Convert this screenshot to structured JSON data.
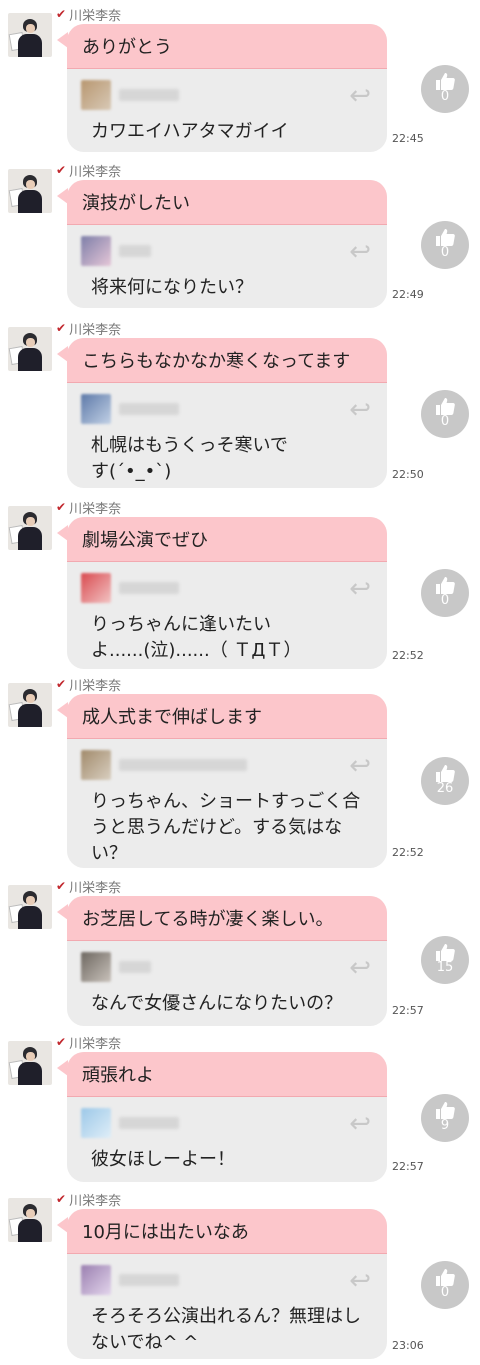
{
  "messages": [
    {
      "name": "川栄李奈",
      "post": "ありがとう",
      "reply_text": "カワエイハアタマガイイ",
      "time": "22:45",
      "likes": "0",
      "quote_colors": [
        "#b89770",
        "#d8c9b6"
      ]
    },
    {
      "name": "川栄李奈",
      "post": "演技がしたい",
      "reply_text": "将来何になりたい？",
      "time": "22:49",
      "likes": "0",
      "quote_colors": [
        "#7d7ea8",
        "#e6c7d8"
      ]
    },
    {
      "name": "川栄李奈",
      "post": "こちらもなかなか寒くなってます",
      "reply_text": "札幌はもうくっそ寒いです(´•_•`)",
      "time": "22:50",
      "likes": "0",
      "quote_colors": [
        "#5d79a8",
        "#c2d1e6"
      ]
    },
    {
      "name": "川栄李奈",
      "post": "劇場公演でぜひ",
      "reply_text": "りっちゃんに逢いたいよ......(泣)......（ ＴДＴ）",
      "time": "22:52",
      "likes": "0",
      "quote_colors": [
        "#d94a4f",
        "#f2c4c4"
      ]
    },
    {
      "name": "川栄李奈",
      "post": "成人式まで伸ばします",
      "reply_text": "りっちゃん、ショートすっごく合うと思うんだけど。する気はない？",
      "time": "22:52",
      "likes": "26",
      "quote_colors": [
        "#a18a6b",
        "#d9cfc0"
      ]
    },
    {
      "name": "川栄李奈",
      "post": "お芝居してる時が凄く楽しい。",
      "reply_text": "なんで女優さんになりたいの？",
      "time": "22:57",
      "likes": "15",
      "quote_colors": [
        "#6d6760",
        "#c9c2bb"
      ]
    },
    {
      "name": "川栄李奈",
      "post": "頑張れよ",
      "reply_text": "彼女ほしーよー！",
      "time": "22:57",
      "likes": "9",
      "quote_colors": [
        "#9cc8e8",
        "#dfeef8"
      ]
    },
    {
      "name": "川栄李奈",
      "post": "10月には出たいなあ",
      "reply_text": "そろそろ公演出れるん？無理はしないでね^ ^",
      "time": "23:06",
      "likes": "0",
      "quote_colors": [
        "#9a7fb0",
        "#e3d5ec"
      ]
    }
  ]
}
